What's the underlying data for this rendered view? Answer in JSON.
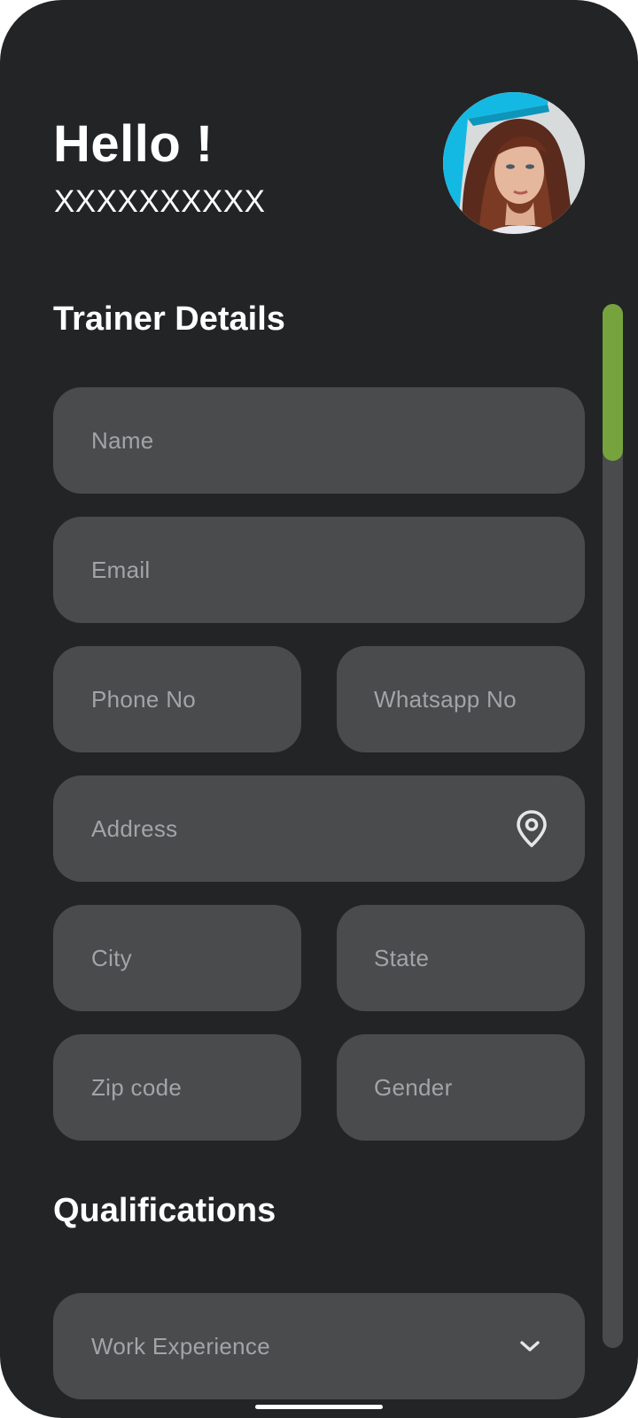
{
  "header": {
    "greeting": "Hello !",
    "username": "XXXXXXXXXX"
  },
  "sections": {
    "trainer_details": "Trainer Details",
    "qualifications": "Qualifications"
  },
  "fields": {
    "name": {
      "placeholder": "Name"
    },
    "email": {
      "placeholder": "Email"
    },
    "phone": {
      "placeholder": "Phone No"
    },
    "whatsapp": {
      "placeholder": "Whatsapp No"
    },
    "address": {
      "placeholder": "Address",
      "icon": "location-pin-icon"
    },
    "city": {
      "placeholder": "City"
    },
    "state": {
      "placeholder": "State"
    },
    "zip": {
      "placeholder": "Zip code"
    },
    "gender": {
      "placeholder": "Gender"
    },
    "work_experience": {
      "placeholder": "Work Experience",
      "icon": "chevron-down-icon"
    }
  },
  "scroll": {
    "position_fraction": 0.0,
    "visible_fraction": 0.15
  },
  "colors": {
    "background": "#232426",
    "field": "#4a4b4d",
    "placeholder": "#a3a4a7",
    "accent": "#76a33d",
    "text": "#ffffff"
  }
}
